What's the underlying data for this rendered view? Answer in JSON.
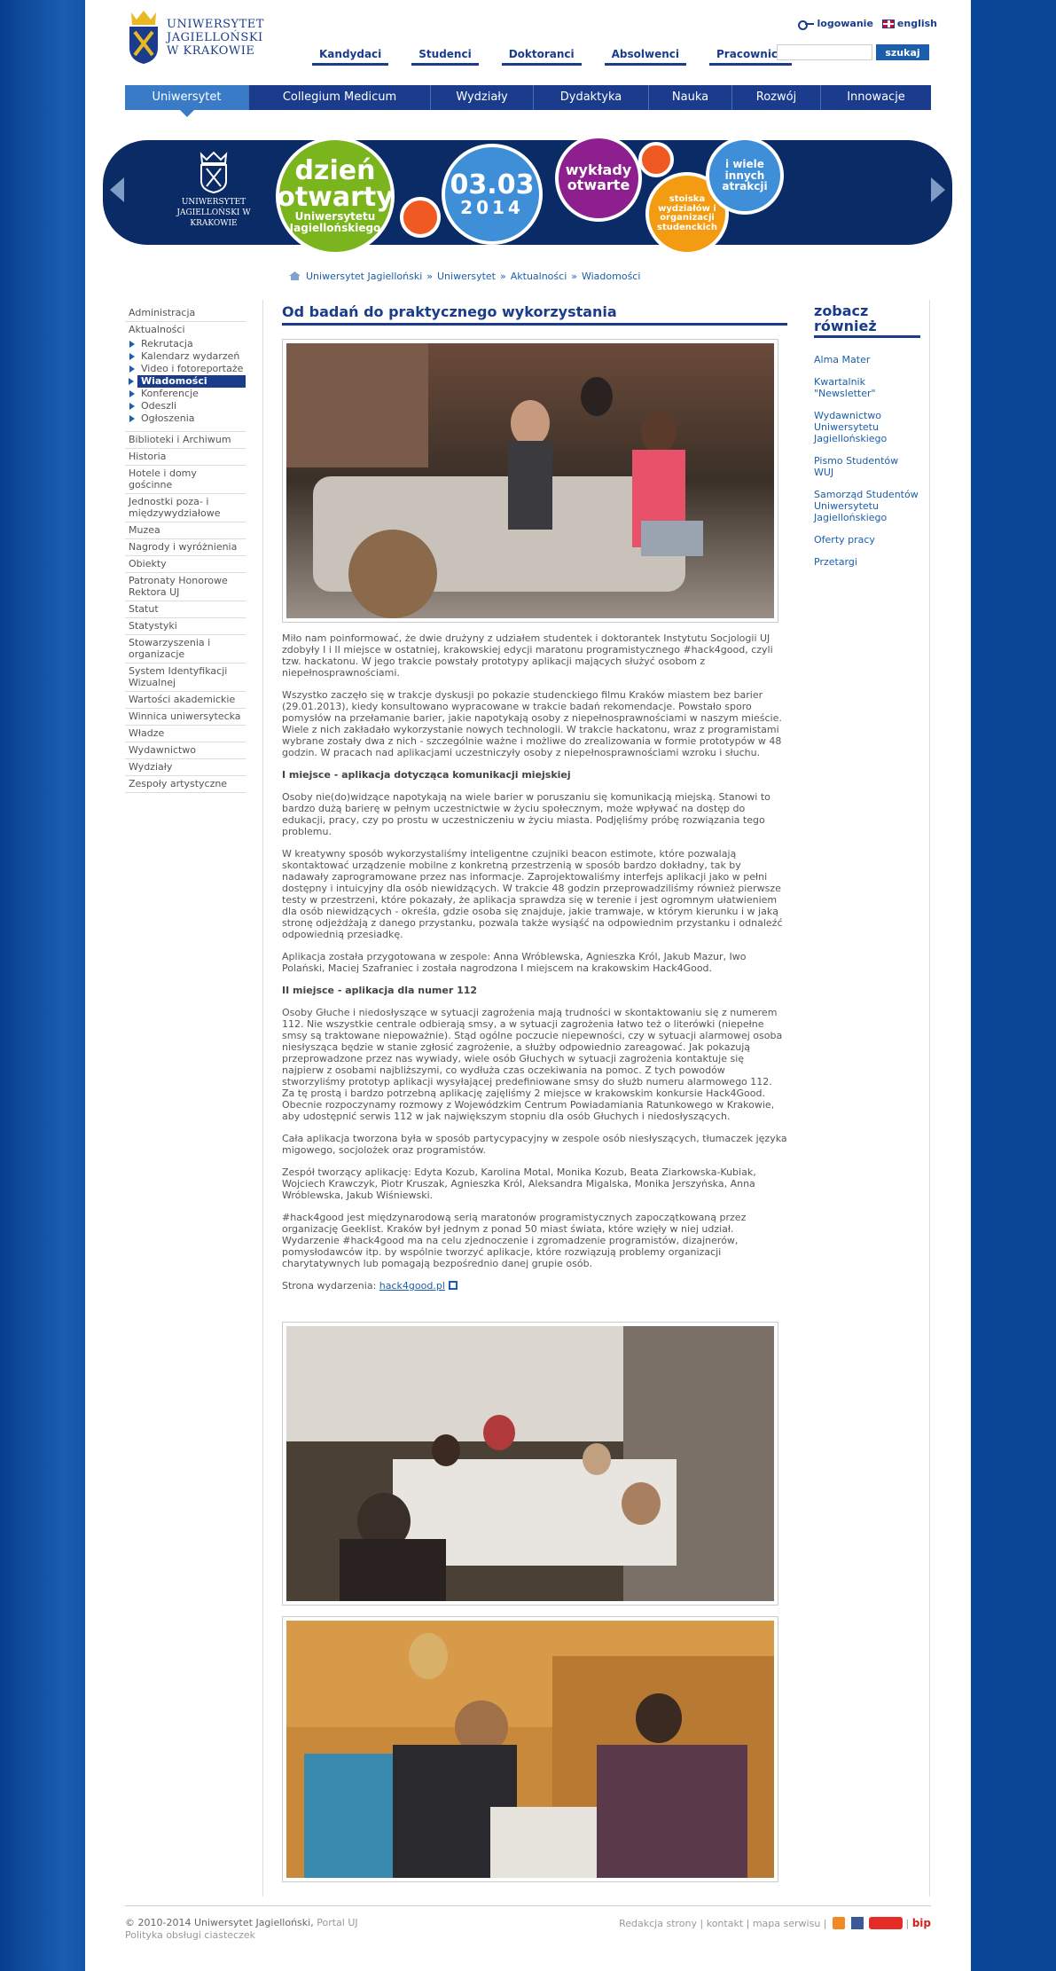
{
  "header": {
    "logo_lines": [
      "UNIWERSYTET",
      "JAGIELLOŃSKI",
      "W KRAKOWIE"
    ],
    "login": "logowanie",
    "english": "english",
    "audiences": [
      "Kandydaci",
      "Studenci",
      "Doktoranci",
      "Absolwenci",
      "Pracownicy"
    ],
    "search_button": "szukaj"
  },
  "mainnav": [
    "Uniwersytet",
    "Collegium Medicum",
    "Wydziały",
    "Dydaktyka",
    "Nauka",
    "Rozwój",
    "Innowacje"
  ],
  "banner": {
    "logo_text": "UNIWERSYTET JAGIELLOŃSKI W KRAKOWIE",
    "event_line1": "dzień",
    "event_line2": "otwarty",
    "event_line3": "Uniwersytetu",
    "event_line4": "Jagiellońskiego",
    "date1": "03.03",
    "date2": "2014",
    "lectures1": "wykłady",
    "lectures2": "otwarte",
    "stands": "stoiska wydziałów i organizacji studenckich",
    "more": "i wiele innych atrakcji"
  },
  "breadcrumb": [
    "Uniwersytet Jagielloński",
    "Uniwersytet",
    "Aktualności",
    "Wiadomości"
  ],
  "leftnav": {
    "top": [
      "Administracja",
      "Aktualności"
    ],
    "sub": [
      "Rekrutacja",
      "Kalendarz wydarzeń",
      "Video i fotoreportaże",
      "Wiadomości",
      "Konferencje",
      "Odeszli",
      "Ogłoszenia"
    ],
    "rest": [
      "Biblioteki i Archiwum",
      "Historia",
      "Hotele i domy gościnne",
      "Jednostki poza- i międzywydziałowe",
      "Muzea",
      "Nagrody i wyróżnienia",
      "Obiekty",
      "Patronaty Honorowe Rektora UJ",
      "Statut",
      "Statystyki",
      "Stowarzyszenia i organizacje",
      "System Identyfikacji Wizualnej",
      "Wartości akademickie",
      "Winnica uniwersytecka",
      "Władze",
      "Wydawnictwo",
      "Wydziały",
      "Zespoły artystyczne"
    ]
  },
  "article": {
    "title": "Od badań do praktycznego wykorzystania",
    "p1": "Miło nam poinformować, że dwie drużyny z udziałem studentek i doktorantek Instytutu Socjologii UJ zdobyły I i II miejsce w ostatniej, krakowskiej edycji maratonu programistycznego #hack4good, czyli tzw. hackatonu. W jego trakcie powstały prototypy aplikacji mających służyć osobom z niepełnosprawnościami.",
    "p2": "Wszystko zaczęło się w trakcje dyskusji po pokazie studenckiego filmu Kraków miastem bez barier (29.01.2013), kiedy konsultowano wypracowane w trakcie badań rekomendacje. Powstało sporo pomysłów na przełamanie barier, jakie napotykają osoby z niepełnosprawnościami w naszym mieście. Wiele z nich zakładało wykorzystanie nowych technologii. W trakcie hackatonu, wraz z programistami wybrane zostały dwa z nich - szczególnie ważne i możliwe do zrealizowania w formie prototypów w 48 godzin. W pracach nad aplikacjami uczestniczyły osoby z niepełnosprawnościami wzroku i słuchu.",
    "h1": "I miejsce - aplikacja dotycząca komunikacji miejskiej",
    "p3": "Osoby nie(do)widzące napotykają na wiele barier w poruszaniu się komunikacją miejską. Stanowi to bardzo dużą barierę w pełnym uczestnictwie w życiu społecznym, może wpływać na dostęp do edukacji, pracy, czy po prostu w uczestniczeniu w życiu miasta. Podjęliśmy próbę rozwiązania tego problemu.",
    "p4": "W kreatywny sposób wykorzystaliśmy inteligentne czujniki beacon estimote, które pozwalają skontaktować urządzenie mobilne z konkretną przestrzenią w sposób bardzo dokładny, tak by nadawały zaprogramowane przez nas informacje. Zaprojektowaliśmy interfejs aplikacji jako w pełni dostępny i intuicyjny dla osób niewidzących. W trakcie 48 godzin przeprowadziliśmy również pierwsze testy w przestrzeni, które pokazały, że aplikacja sprawdza się w terenie i jest ogromnym ułatwieniem dla osób niewidzących - określa, gdzie osoba się znajduje, jakie tramwaje, w którym kierunku i w jaką stronę odjeżdżają z danego przystanku, pozwala także wysiąść na odpowiednim przystanku i odnaleźć odpowiednią przesiadkę.",
    "p5": "Aplikacja została przygotowana w zespole: Anna Wróblewska, Agnieszka Król, Jakub Mazur, Iwo Polański, Maciej Szafraniec i została nagrodzona I miejscem na krakowskim Hack4Good.",
    "h2": "II miejsce - aplikacja dla numer 112",
    "p6": "Osoby Głuche i niedosłyszące w sytuacji zagrożenia mają trudności w skontaktowaniu się z numerem 112. Nie wszystkie centrale odbierają smsy, a w sytuacji zagrożenia łatwo też o literówki (niepełne smsy są traktowane niepoważnie). Stąd ogólne poczucie niepewności, czy w sytuacji alarmowej osoba niesłysząca będzie w stanie zgłosić zagrożenie, a służby odpowiednio zareagować. Jak pokazują przeprowadzone przez nas wywiady, wiele osób Głuchych w sytuacji zagrożenia kontaktuje się najpierw z osobami najbliższymi, co wydłuża czas oczekiwania na pomoc. Z tych powodów stworzyliśmy prototyp aplikacji wysyłającej predefiniowane smsy do służb numeru alarmowego 112. Za tę prostą i bardzo potrzebną aplikację zajęliśmy 2 miejsce w krakowskim konkursie Hack4Good. Obecnie rozpoczynamy rozmowy z Wojewódzkim Centrum Powiadamiania Ratunkowego w Krakowie, aby udostępnić serwis 112 w jak największym stopniu dla osób Głuchych i niedosłyszących.",
    "p7": "Cała aplikacja tworzona była w sposób partycypacyjny w zespole osób niesłyszących, tłumaczek języka migowego, socjolożek oraz programistów.",
    "p8": "Zespół tworzący aplikację: Edyta Kozub, Karolina Motal, Monika Kozub, Beata Ziarkowska-Kubiak, Wojciech Krawczyk, Piotr Kruszak, Agnieszka Król, Aleksandra Migalska, Monika Jerszyńska, Anna Wróblewska, Jakub Wiśniewski.",
    "p9": "#hack4good jest międzynarodową serią maratonów programistycznych zapoczątkowaną przez organizację Geeklist. Kraków był jednym z ponad 50 miast świata, które wzięły w niej udział. Wydarzenie #hack4good ma na celu zjednoczenie i zgromadzenie programistów, dizajnerów, pomysłodawców itp. by wspólnie tworzyć aplikacje, które rozwiązują problemy organizacji charytatywnych lub pomagają bezpośrednio danej grupie osób.",
    "site_label": "Strona wydarzenia:",
    "site_link": "hack4good.pl"
  },
  "rightcol": {
    "title": "zobacz również",
    "links": [
      "Alma Mater",
      "Kwartalnik \"Newsletter\"",
      "Wydawnictwo Uniwersytetu Jagiellońskiego",
      "Pismo Studentów WUJ",
      "Samorząd Studentów Uniwersytetu Jagiellońskiego",
      "Oferty pracy",
      "Przetargi"
    ]
  },
  "footer": {
    "copyright": "© 2010-2014 Uniwersytet Jagielloński,",
    "portal": "Portal UJ",
    "cookies": "Polityka obsługi ciasteczek",
    "links": [
      "Redakcja strony",
      "kontakt",
      "mapa serwisu"
    ],
    "bip": "bip"
  },
  "colors": {
    "brand": "#1b3c8c",
    "link": "#1b5eab",
    "accent_green": "#7ab51d",
    "accent_purple": "#8e1f8e",
    "accent_orange": "#f05a22"
  }
}
